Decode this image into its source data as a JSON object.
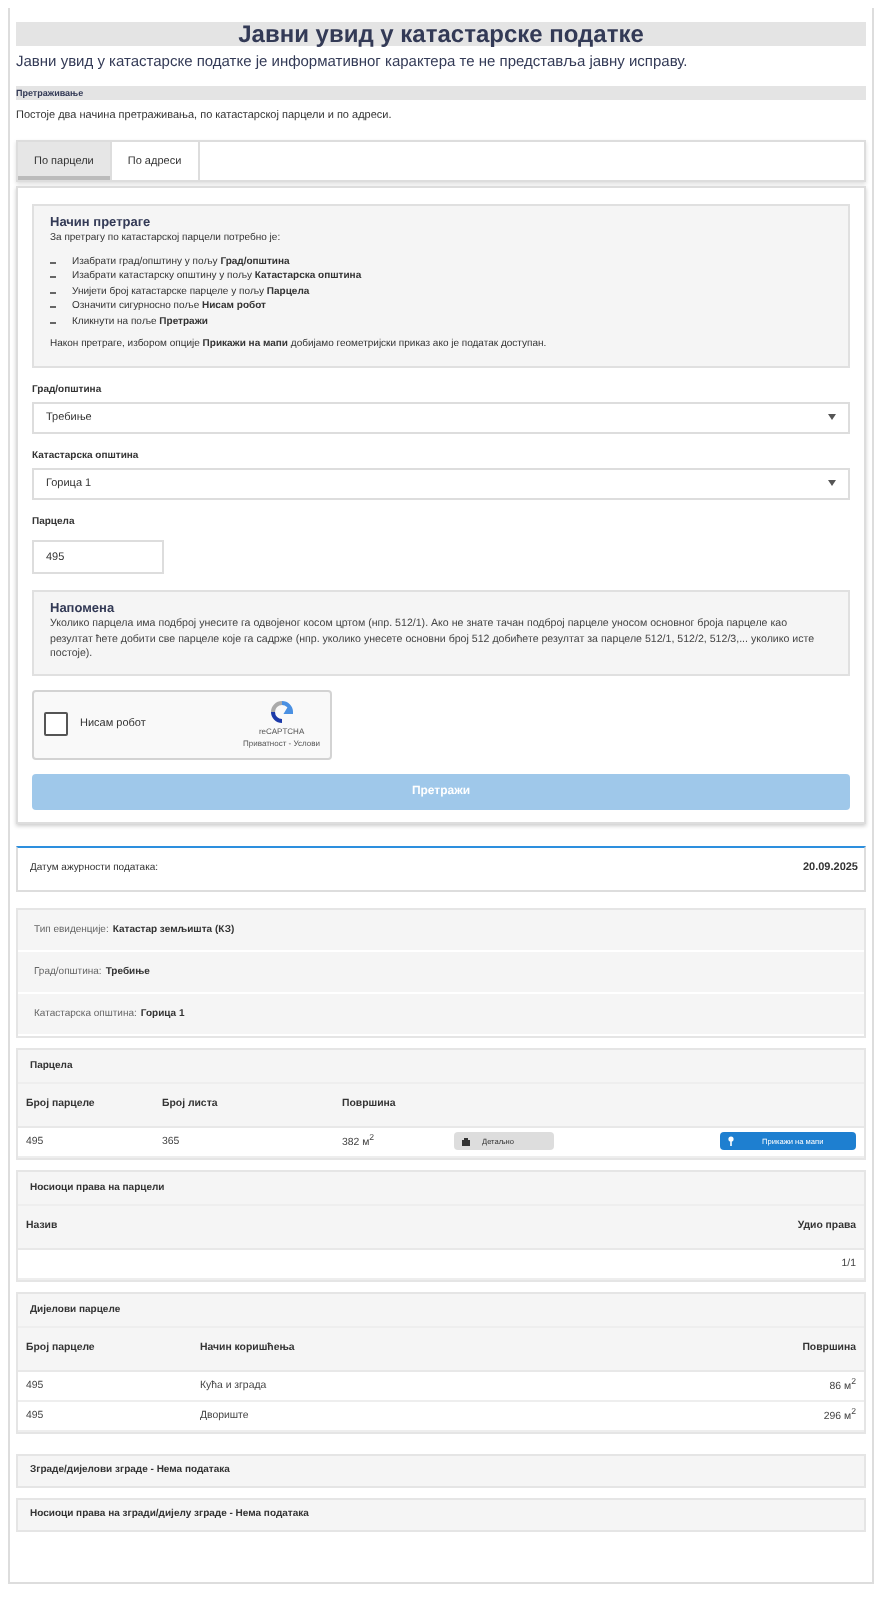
{
  "title": "Јавни увид у катастарске податке",
  "notice": "Јавни увид у катастарске податке је информативног карактера те не представља јавну исправу.",
  "section_heading": "Претраживање",
  "intro": "Постоје два начина претраживања, по катастарској парцели и по адреси.",
  "tabs": [
    {
      "label": "По парцели",
      "selected": true
    },
    {
      "label": "По адреси",
      "selected": false
    }
  ],
  "instructions": {
    "heading": "Начин претраге",
    "lead": "За претрагу по катастарској парцели потребно је:",
    "steps": [
      "Изабрати град/општину у пољу **Град/општина**",
      "Изабрати катастарску општину у пољу **Катастарска општина**",
      "Унијети број катастарске парцеле у пољу **Парцела**",
      "Означити сигурносно поље **Нисам робот**",
      "Кликнути на поље **Претражи**"
    ],
    "footer": "Након претраге, избором опције **Прикажи на мапи** добијамо геометријски приказ ако је податак доступан."
  },
  "fields": [
    {
      "kind": "select",
      "label": "Град/општина",
      "value": "Требиње"
    },
    {
      "kind": "select",
      "label": "Катастарска општина",
      "value": "Горица 1"
    },
    {
      "kind": "text",
      "label": "Парцела",
      "value": "495"
    }
  ],
  "note": {
    "heading": "Напомена",
    "text": "Уколико парцела има подброј унесите га одвојеног косом цртом (нпр. 512/1). Ако не знате тачан подброј парцеле уносом основног броја парцеле као резултат ћете добити све парцеле које га садрже (нпр. уколико унесете основни број 512 добићете резултат за парцеле 512/1, 512/2, 512/3,... уколико исте постоје)."
  },
  "captcha": {
    "label": "Нисам робот",
    "checked": false,
    "brand": "reCAPTCHA",
    "links": "Приватност - Услови"
  },
  "search_button": {
    "label": "Претражи",
    "disabled": true
  },
  "data_date": {
    "label": "Датум ажурности података:",
    "value": "20.09.2025"
  },
  "info": [
    {
      "label": "Тип евиденције:",
      "value": "Катастар земљишта (КЗ)"
    },
    {
      "label": "Град/општина:",
      "value": "Требиње"
    },
    {
      "label": "Катастарска општина:",
      "value": "Горица 1"
    }
  ],
  "parcel": {
    "title": "Парцела",
    "columns": [
      "Број парцеле",
      "Број листа",
      "Површина"
    ],
    "rows": [
      {
        "cells": [
          "495",
          "365",
          "382 м$^{2}$"
        ],
        "details_button": "Детаљно",
        "map_button": "Прикажи на мапи"
      }
    ]
  },
  "holders": {
    "title": "Носиоци права на парцели",
    "columns": [
      "Назив",
      "Удио права"
    ],
    "rows": [
      {
        "share": "1/1"
      }
    ]
  },
  "parts": {
    "title": "Дијелови парцеле",
    "columns": [
      "Број парцеле",
      "Начин коришћења",
      "Површина"
    ],
    "rows": [
      [
        "495",
        "Кућа и зграда",
        "86 м$^{2}$"
      ],
      [
        "495",
        "Двориште",
        "296 м$^{2}$"
      ]
    ]
  },
  "empty_sections": [
    "Зграде/дијелови зграде - Нема података",
    "Носиоци права на згради/дијелу зграде - Нема података"
  ]
}
